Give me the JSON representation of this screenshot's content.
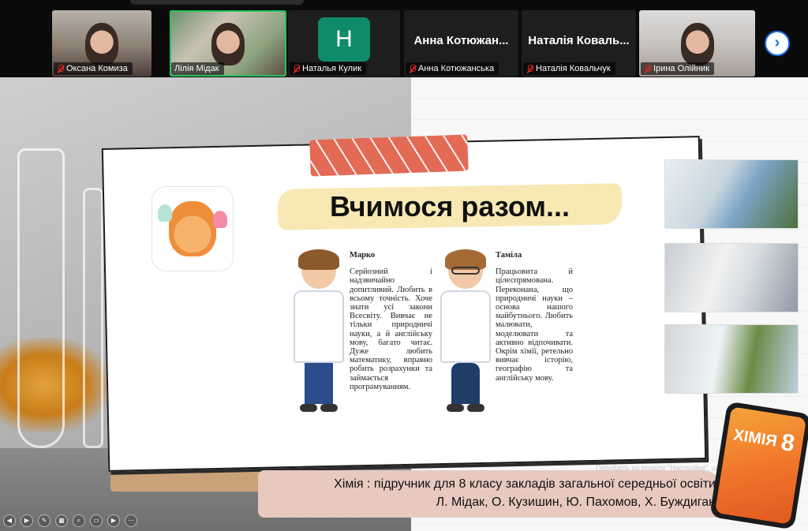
{
  "participants": [
    {
      "name": "Оксана Комиза",
      "muted": true,
      "type": "video"
    },
    {
      "name": "Лілія Мідак",
      "muted": false,
      "type": "video",
      "active": true
    },
    {
      "name": "Наталья Кулик",
      "muted": true,
      "type": "avatar",
      "initial": "H"
    },
    {
      "name": "Анна Котюжанська",
      "display_name": "Анна Котюжан...",
      "muted": true,
      "type": "name"
    },
    {
      "name": "Наталія Ковальчук",
      "display_name": "Наталія Коваль...",
      "muted": true,
      "type": "name"
    },
    {
      "name": "Ірина Олійник",
      "muted": true,
      "type": "video"
    }
  ],
  "strip": {
    "next_icon": "chevron-right-icon",
    "next_glyph": "›"
  },
  "slide": {
    "title": "Вчимося разом...",
    "characters": [
      {
        "name": "Марко",
        "text": "Серйозний і надзвичайно допитливий. Любить в всьому точність. Хоче знати усі закони Всесвіту. Вивчає не тільки природничі науки, а й англійську мову, багато читає. Дуже любить математику, вправно робить розрахунки та займається програмуванням."
      },
      {
        "name": "Таміла",
        "text": "Працьовита й цілеспрямована. Переконана, що природничі науки – основа нашого майбутнього. Любить малювати, моделювати та активно відпочивати. Окрім хімії, ретельно вивчає історію, географію та англійську мову."
      }
    ],
    "caption_line1": "Хімія : підручник для 8 класу закладів загальної середньої освіти",
    "caption_line2": "Л. Мідак, О. Кузишин, Ю. Пахомов, Х. Буждиган",
    "watermark": "Перейдіть до розділу \"Настройки\", щоб",
    "book_title": "ХІМІЯ",
    "book_grade": "8"
  },
  "toolbar": {
    "buttons": [
      {
        "name": "prev-icon",
        "glyph": "◀"
      },
      {
        "name": "next-icon",
        "glyph": "▶"
      },
      {
        "name": "pen-icon",
        "glyph": "✎"
      },
      {
        "name": "slides-icon",
        "glyph": "▦"
      },
      {
        "name": "zoom-icon",
        "glyph": "⌕"
      },
      {
        "name": "subtitles-icon",
        "glyph": "▭"
      },
      {
        "name": "camera-icon",
        "glyph": "▶"
      },
      {
        "name": "more-icon",
        "glyph": "⋯"
      }
    ]
  },
  "colors": {
    "active_border": "#22c55e",
    "mute_red": "#e02424",
    "accent_blue": "#1a73e8",
    "ribbon": "#e36a55",
    "caption_bg": "#e8c9bf"
  }
}
